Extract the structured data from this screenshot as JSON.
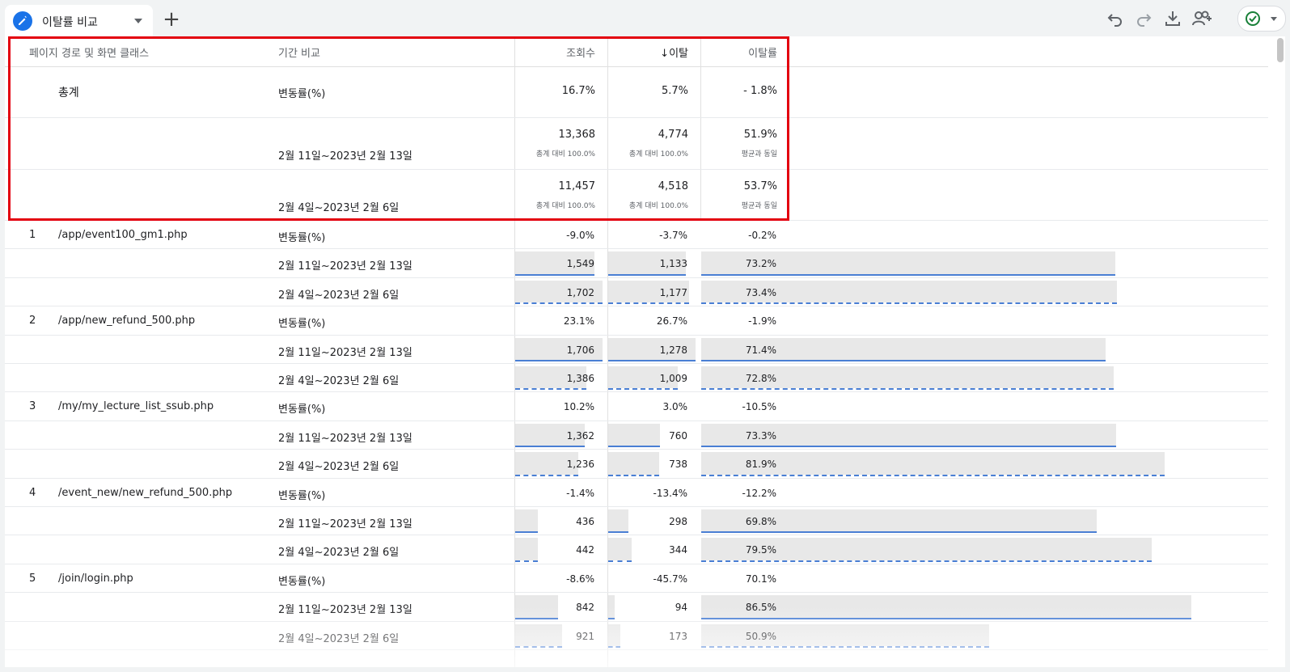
{
  "tab": {
    "title": "이탈률 비교",
    "add_icon": "plus-icon"
  },
  "toolbar": {
    "icons": [
      "undo-icon",
      "redo-icon",
      "download-icon",
      "share-user-icon",
      "check-circle-icon"
    ]
  },
  "table": {
    "headers": {
      "page": "페이지 경로 및 화면 클래스",
      "period": "기간 비교",
      "views": "조회수",
      "bounces": "↓이탈",
      "bounce_rate": "이탈률"
    },
    "totals": {
      "label": "총계",
      "change": {
        "label": "변동률(%)",
        "views": "16.7%",
        "bounces": "5.7%",
        "bounce_rate": "- 1.8%"
      },
      "current": {
        "label": "2월 11일~2023년 2월 13일",
        "views": "13,368",
        "views_sub": "총계 대비 100.0%",
        "bounces": "4,774",
        "bounces_sub": "총계 대비 100.0%",
        "bounce_rate": "51.9%",
        "bounce_rate_sub": "평균과 동일"
      },
      "previous": {
        "label": "2월 4일~2023년 2월 6일",
        "views": "11,457",
        "views_sub": "총계 대비 100.0%",
        "bounces": "4,518",
        "bounces_sub": "총계 대비 100.0%",
        "bounce_rate": "53.7%",
        "bounce_rate_sub": "평균과 동일"
      }
    },
    "rows": [
      {
        "index": "1",
        "path": "/app/event100_gm1.php",
        "change": {
          "label": "변동률(%)",
          "views": "-9.0%",
          "bounces": "-3.7%",
          "bounce_rate": "-0.2%"
        },
        "current": {
          "label": "2월 11일~2023년 2월 13일",
          "views": "1,549",
          "bounces": "1,133",
          "bounce_rate": "73.2%"
        },
        "previous": {
          "label": "2월 4일~2023년 2월 6일",
          "views": "1,702",
          "bounces": "1,177",
          "bounce_rate": "73.4%"
        }
      },
      {
        "index": "2",
        "path": "/app/new_refund_500.php",
        "change": {
          "label": "변동률(%)",
          "views": "23.1%",
          "bounces": "26.7%",
          "bounce_rate": "-1.9%"
        },
        "current": {
          "label": "2월 11일~2023년 2월 13일",
          "views": "1,706",
          "bounces": "1,278",
          "bounce_rate": "71.4%"
        },
        "previous": {
          "label": "2월 4일~2023년 2월 6일",
          "views": "1,386",
          "bounces": "1,009",
          "bounce_rate": "72.8%"
        }
      },
      {
        "index": "3",
        "path": "/my/my_lecture_list_ssub.php",
        "change": {
          "label": "변동률(%)",
          "views": "10.2%",
          "bounces": "3.0%",
          "bounce_rate": "-10.5%"
        },
        "current": {
          "label": "2월 11일~2023년 2월 13일",
          "views": "1,362",
          "bounces": "760",
          "bounce_rate": "73.3%"
        },
        "previous": {
          "label": "2월 4일~2023년 2월 6일",
          "views": "1,236",
          "bounces": "738",
          "bounce_rate": "81.9%"
        }
      },
      {
        "index": "4",
        "path": "/event_new/new_refund_500.php",
        "change": {
          "label": "변동률(%)",
          "views": "-1.4%",
          "bounces": "-13.4%",
          "bounce_rate": "-12.2%"
        },
        "current": {
          "label": "2월 11일~2023년 2월 13일",
          "views": "436",
          "bounces": "298",
          "bounce_rate": "69.8%"
        },
        "previous": {
          "label": "2월 4일~2023년 2월 6일",
          "views": "442",
          "bounces": "344",
          "bounce_rate": "79.5%"
        }
      },
      {
        "index": "5",
        "path": "/join/login.php",
        "change": {
          "label": "변동률(%)",
          "views": "-8.6%",
          "bounces": "-45.7%",
          "bounce_rate": "70.1%"
        },
        "current": {
          "label": "2월 11일~2023년 2월 13일",
          "views": "842",
          "bounces": "94",
          "bounce_rate": "86.5%"
        },
        "previous": {
          "label": "2월 4일~2023년 2월 6일",
          "views": "921",
          "bounces": "173",
          "bounce_rate": "50.9%"
        }
      }
    ]
  },
  "colors": {
    "highlight": "#e3000f",
    "accent": "#1a73e8",
    "bar_fill": "#e8e8e8",
    "bar_underline": "#4a7fd4"
  }
}
